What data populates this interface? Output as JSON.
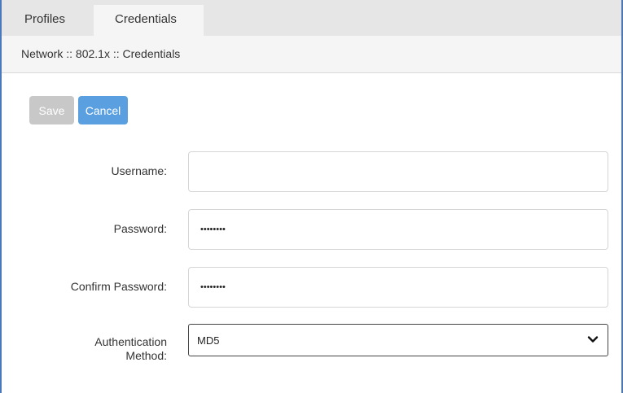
{
  "tabs": [
    {
      "label": "Profiles",
      "active": false
    },
    {
      "label": "Credentials",
      "active": true
    }
  ],
  "breadcrumb": "Network :: 802.1x :: Credentials",
  "toolbar": {
    "save_label": "Save",
    "cancel_label": "Cancel"
  },
  "form": {
    "username": {
      "label": "Username:",
      "value": ""
    },
    "password": {
      "label": "Password:",
      "value": "••••••••"
    },
    "confirm_password": {
      "label": "Confirm Password:",
      "value": "••••••••"
    },
    "auth_method": {
      "label_line1": "Authentication",
      "label_line2": "Method:",
      "value": "MD5"
    }
  },
  "colors": {
    "frame_border": "#4a78b8",
    "save_disabled": "#c8c8c8",
    "cancel_accent": "#5aa0e0",
    "tabbar_bg": "#e6e6e6",
    "active_tab_bg": "#f5f5f5"
  },
  "icons": {
    "dropdown": "chevron-down-icon"
  }
}
